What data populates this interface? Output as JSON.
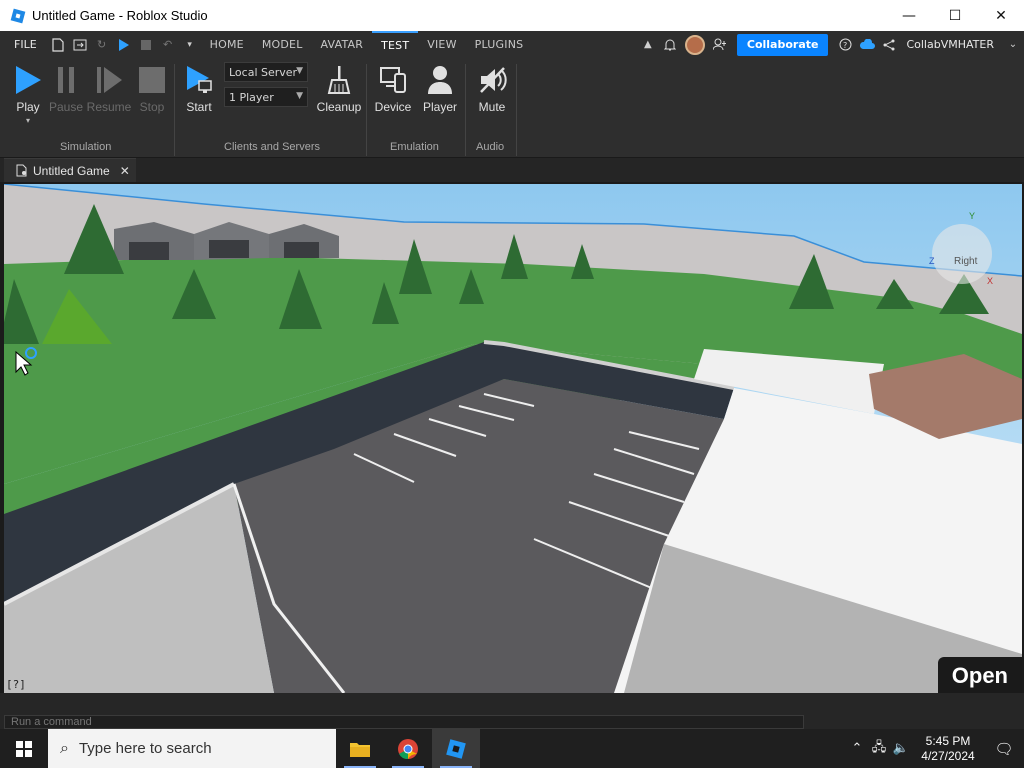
{
  "window": {
    "title": "Untitled Game - Roblox Studio",
    "minimize": "—",
    "maximize": "☐",
    "close": "✕"
  },
  "menubar": {
    "file": "FILE",
    "tabs": [
      "HOME",
      "MODEL",
      "AVATAR",
      "TEST",
      "VIEW",
      "PLUGINS"
    ],
    "active_tab": "TEST",
    "collaborate": "Collaborate",
    "username": "CollabVMHATER"
  },
  "ribbon": {
    "simulation": {
      "play": "Play",
      "pause": "Pause",
      "resume": "Resume",
      "stop": "Stop",
      "group": "Simulation"
    },
    "clients": {
      "start": "Start",
      "server_select": "Local Server",
      "players_select": "1 Player",
      "cleanup": "Cleanup",
      "group": "Clients and Servers"
    },
    "emulation": {
      "device": "Device",
      "player": "Player",
      "group": "Emulation"
    },
    "audio": {
      "mute": "Mute",
      "group": "Audio"
    }
  },
  "doc_tab": {
    "label": "Untitled Game",
    "close": "✕"
  },
  "viewport": {
    "open_button": "Open",
    "help_tag": "[?]",
    "gizmo_face": "Right",
    "axes": [
      "Y",
      "Z",
      "X"
    ]
  },
  "command_bar": {
    "placeholder": "Run a command"
  },
  "taskbar": {
    "search_placeholder": "Type here to search",
    "time": "5:45 PM",
    "date": "4/27/2024"
  },
  "colors": {
    "accent": "#0a84ff",
    "active_tab_border": "#3aa0ff",
    "grass": "#4e9a4a",
    "asphalt": "#2f3640"
  }
}
